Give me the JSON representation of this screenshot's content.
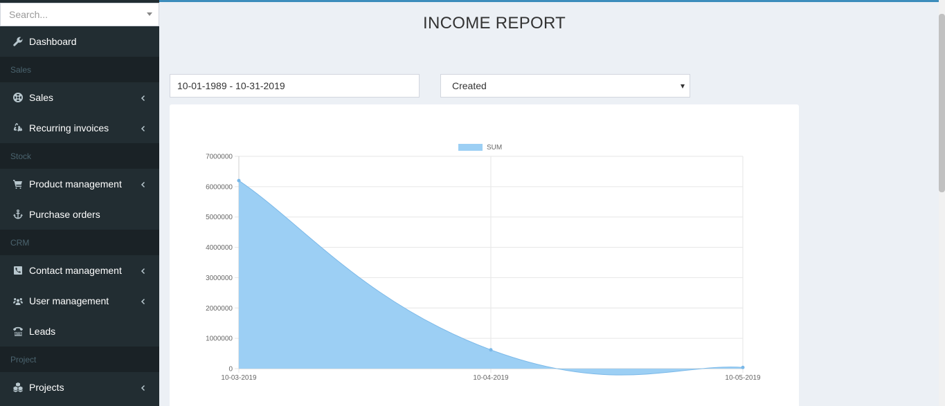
{
  "search": {
    "placeholder": "Search..."
  },
  "sidebar": {
    "items": [
      {
        "type": "item",
        "label": "Dashboard",
        "icon": "wrench-icon",
        "chevron": false
      },
      {
        "type": "header",
        "label": "Sales"
      },
      {
        "type": "item",
        "label": "Sales",
        "icon": "life-ring-icon",
        "chevron": true
      },
      {
        "type": "item",
        "label": "Recurring invoices",
        "icon": "recycle-icon",
        "chevron": true
      },
      {
        "type": "header",
        "label": "Stock"
      },
      {
        "type": "item",
        "label": "Product management",
        "icon": "cart-icon",
        "chevron": true
      },
      {
        "type": "item",
        "label": "Purchase orders",
        "icon": "anchor-icon",
        "chevron": false
      },
      {
        "type": "header",
        "label": "CRM"
      },
      {
        "type": "item",
        "label": "Contact management",
        "icon": "phone-square-icon",
        "chevron": true
      },
      {
        "type": "item",
        "label": "User management",
        "icon": "users-icon",
        "chevron": true
      },
      {
        "type": "item",
        "label": "Leads",
        "icon": "tty-icon",
        "chevron": false
      },
      {
        "type": "header",
        "label": "Project"
      },
      {
        "type": "item",
        "label": "Projects",
        "icon": "cubes-icon",
        "chevron": true
      }
    ]
  },
  "main": {
    "title": "INCOME REPORT",
    "date_range": "10-01-1989 - 10-31-2019",
    "status_filter": "Created"
  },
  "colors": {
    "sidebar_bg": "#222d32",
    "accent": "#3c8dbc",
    "series_fill": "#9ccff4",
    "series_stroke": "#7ab8e8"
  },
  "chart_data": {
    "type": "area",
    "x": [
      "10-03-2019",
      "10-04-2019",
      "10-05-2019"
    ],
    "series": [
      {
        "name": "SUM",
        "values": [
          6200000,
          620000,
          40000
        ]
      }
    ],
    "ylim": [
      0,
      7000000
    ],
    "yticks": [
      0,
      1000000,
      2000000,
      3000000,
      4000000,
      5000000,
      6000000,
      7000000
    ],
    "legend": "top-center",
    "grid": true
  }
}
